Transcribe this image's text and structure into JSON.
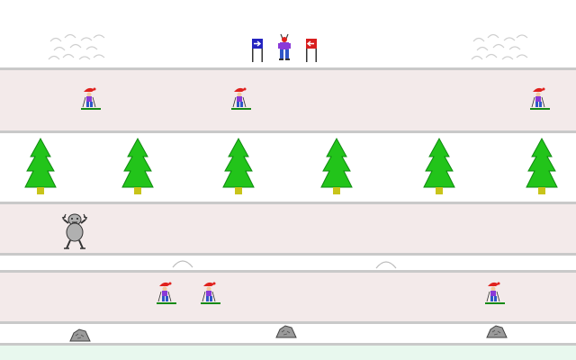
{
  "game": {
    "colors": {
      "snow": "#ffffff",
      "lane": "#f3eaea",
      "lane_line": "#c9c9c9",
      "mint_strip": "#e8f8ee",
      "tree_green": "#22c41a",
      "tree_dark": "#0f8a10",
      "trunk": "#c8c41a",
      "skier_hat": "#e0221e",
      "skier_body": "#8a3ad8",
      "skier_legs": "#2f57c8",
      "ski": "#168a16",
      "flag_left": "#2424c0",
      "flag_right": "#d81e1e",
      "yeti": "#b0b0b0",
      "rock": "#9a9a9a"
    },
    "sprites": {
      "moguls": [
        "mogul-cluster-icon",
        "mogul-cluster-icon"
      ],
      "start_gate": [
        "flag-arrow-right-icon",
        "player-skier-icon",
        "flag-arrow-left-icon"
      ],
      "lane1_skiers": [
        "skier-icon",
        "skier-icon",
        "skier-icon"
      ],
      "trees": [
        "pine-tree-icon",
        "pine-tree-icon",
        "pine-tree-icon",
        "pine-tree-icon",
        "pine-tree-icon",
        "pine-tree-icon"
      ],
      "yeti": "yeti-icon",
      "bumps": [
        "snow-bump-icon",
        "snow-bump-icon"
      ],
      "lane4_skiers": [
        "skier-icon",
        "skier-icon",
        "skier-icon"
      ],
      "rocks": [
        "rock-icon",
        "rock-icon",
        "rock-icon"
      ]
    }
  }
}
